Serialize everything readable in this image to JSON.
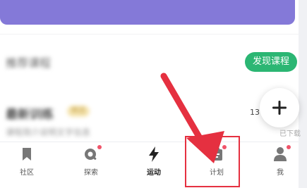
{
  "header": {
    "banner_color": "#8479d8"
  },
  "section": {
    "title_blurred": "推荐课程",
    "discover_button_label": "发现课程"
  },
  "course": {
    "name_blurred": "最新训练",
    "tag_blurred": "精选",
    "sub_blurred": "课程简介说明文字信息",
    "count_partial": "13",
    "download_partial": "已下载"
  },
  "fab": {
    "icon": "plus-icon"
  },
  "tabbar": {
    "tabs": [
      {
        "label": "社区",
        "icon": "bookmark-icon",
        "badge": false
      },
      {
        "label": "探索",
        "icon": "explore-icon",
        "badge": true
      },
      {
        "label": "运动",
        "icon": "lightning-icon",
        "badge": false,
        "active": true
      },
      {
        "label": "计划",
        "icon": "plan-icon",
        "badge": true
      },
      {
        "label": "我",
        "icon": "person-icon",
        "badge": true
      }
    ]
  },
  "annotation": {
    "color": "#e53040"
  },
  "colors": {
    "accent_green": "#2bb673",
    "badge_red": "#f0546a"
  }
}
